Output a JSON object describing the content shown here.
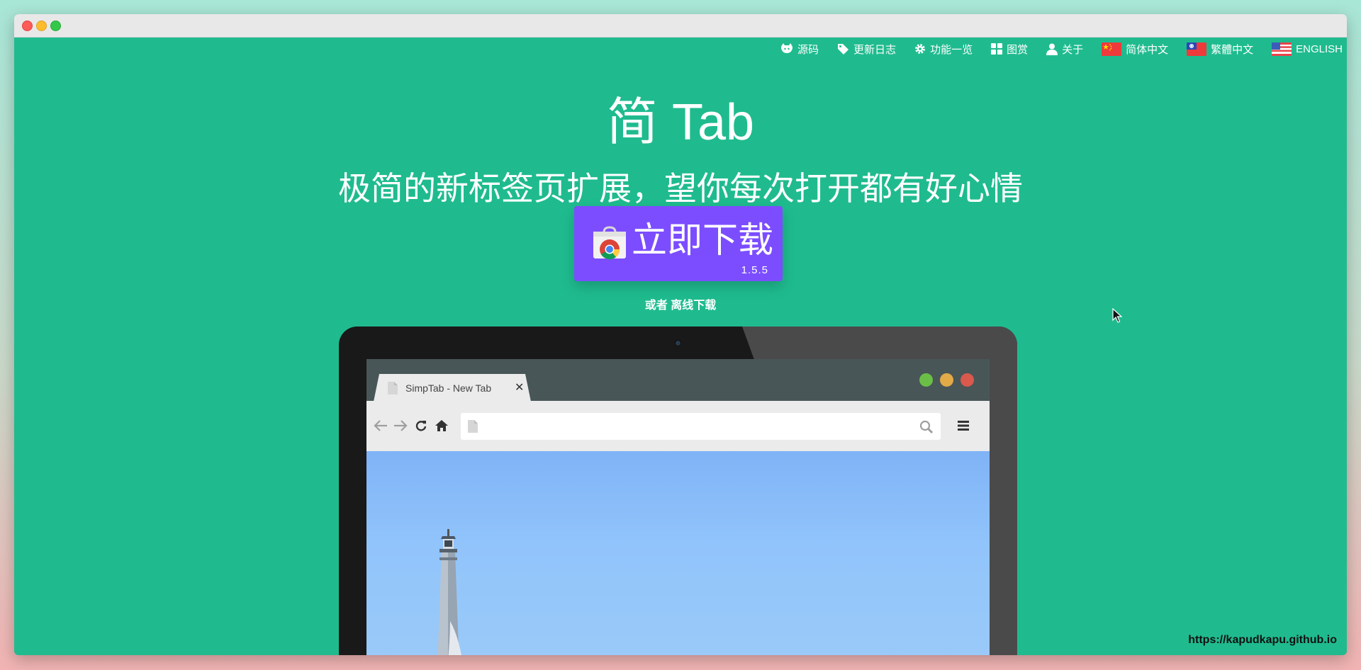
{
  "nav": {
    "items": [
      {
        "label": "源码",
        "icon": "github-icon"
      },
      {
        "label": "更新日志",
        "icon": "tag-icon"
      },
      {
        "label": "功能一览",
        "icon": "gear-icon"
      },
      {
        "label": "图赏",
        "icon": "grid-icon"
      },
      {
        "label": "关于",
        "icon": "user-icon"
      },
      {
        "label": "简体中文",
        "icon": "china-flag-icon"
      },
      {
        "label": "繁體中文",
        "icon": "taiwan-flag-icon"
      },
      {
        "label": "ENGLISH",
        "icon": "us-flag-icon"
      }
    ]
  },
  "hero": {
    "title": "简 Tab",
    "subtitle": "极简的新标签页扩展，望你每次打开都有好心情"
  },
  "download": {
    "label": "立即下载",
    "version": "1.5.5",
    "offline_text": "或者 离线下载",
    "icon": "chrome-web-store-icon"
  },
  "preview": {
    "tab_title": "SimpTab - New Tab",
    "tab_close": "✕",
    "window_dot_colors": [
      "#6bbf47",
      "#e3aa48",
      "#d9594c"
    ]
  },
  "footer": {
    "url": "https://kapudkapu.github.io"
  },
  "colors": {
    "background": "#1fbb8f",
    "button": "#7c4dff"
  }
}
